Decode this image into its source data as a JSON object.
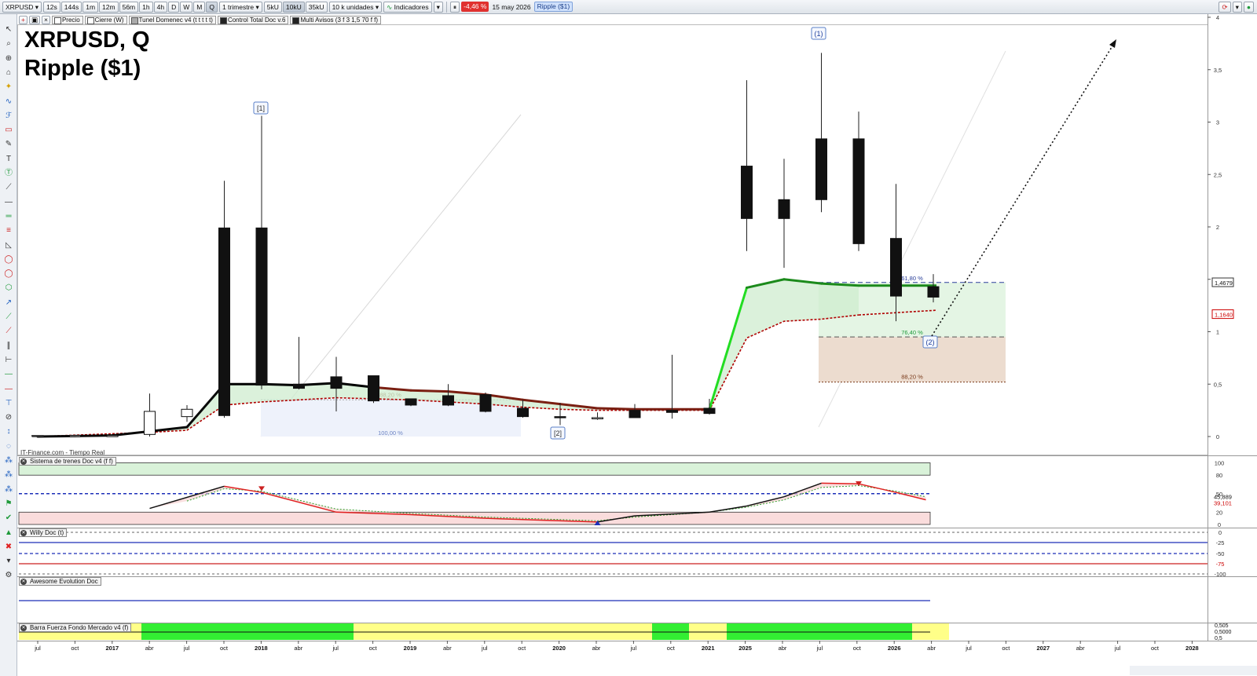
{
  "toolbar": {
    "symbol": "XRPUSD",
    "intervals": [
      "12s",
      "144s",
      "1m",
      "12m",
      "56m",
      "1h",
      "4h",
      "D",
      "W",
      "M",
      "Q"
    ],
    "selected_interval": "Q",
    "period": "1 trimestre",
    "units": [
      "5kU",
      "10kU",
      "35kU"
    ],
    "selected_unit": "10kU",
    "units_select": "10 k unidades",
    "indicators_label": "Indicadores",
    "change_pct": "-4,46 %",
    "date": "15 may 2026",
    "instrument_badge": "Ripple ($1)"
  },
  "legend": [
    "Precio",
    "Cierre (W)",
    "Tunel Domenec v4 (t t t t t)",
    "Control Total Doc v.6",
    "Multi Avisos (3 f 3 1,5 70 f f)"
  ],
  "title": {
    "line1": "XRPUSD, Q",
    "line2": "Ripple ($1)"
  },
  "source": "IT-Finance.com - Tiempo Real",
  "colors": {
    "bull": "#ffffff",
    "bear": "#111111",
    "tunnel_up": "#22dd22",
    "tunnel_flat": "#000000",
    "tunnel_down": "#7a1f12",
    "support_dash": "#b00000",
    "fib_fill_green": "#cdeccd",
    "fib_fill_brown": "#e8d6c8"
  },
  "y_axis": {
    "ticks": [
      "4",
      "3,5",
      "3",
      "2,5",
      "2",
      "1,5",
      "1",
      "0,5",
      "0"
    ],
    "current_price": "1,4679",
    "support_price": "1,1640"
  },
  "fib_labels": {
    "a": "61,80 %",
    "b": "76,40 %",
    "c": "88,20 %",
    "d": "88,20 %",
    "e": "100,00 %"
  },
  "wave_labels": {
    "w1": "[1]",
    "w2": "[2]",
    "w1b": "(1)",
    "w2b": "(2)"
  },
  "x_axis": [
    "jul",
    "oct",
    "2017",
    "abr",
    "jul",
    "oct",
    "2018",
    "abr",
    "jul",
    "oct",
    "2019",
    "abr",
    "jul",
    "oct",
    "2020",
    "abr",
    "jul",
    "oct",
    "2021",
    "2025",
    "abr",
    "jul",
    "oct",
    "2026",
    "abr",
    "jul",
    "oct",
    "2027",
    "abr",
    "jul",
    "oct",
    "2028"
  ],
  "chart_data": {
    "type": "candlestick",
    "timeframe": "Q",
    "y_range": [
      0,
      4
    ],
    "candles": [
      {
        "i": 0,
        "o": 0.01,
        "h": 0.01,
        "l": 0.0,
        "c": 0.01
      },
      {
        "i": 1,
        "o": 0.01,
        "h": 0.01,
        "l": 0.0,
        "c": 0.01
      },
      {
        "i": 2,
        "o": 0.01,
        "h": 0.01,
        "l": 0.0,
        "c": 0.01
      },
      {
        "i": 3,
        "o": 0.02,
        "h": 0.41,
        "l": 0.0,
        "c": 0.24
      },
      {
        "i": 4,
        "o": 0.19,
        "h": 0.3,
        "l": 0.14,
        "c": 0.26
      },
      {
        "i": 5,
        "o": 1.99,
        "h": 2.44,
        "l": 0.18,
        "c": 0.2
      },
      {
        "i": 6,
        "o": 1.99,
        "h": 3.06,
        "l": 0.45,
        "c": 0.49
      },
      {
        "i": 7,
        "o": 0.5,
        "h": 0.95,
        "l": 0.45,
        "c": 0.46
      },
      {
        "i": 8,
        "o": 0.57,
        "h": 0.76,
        "l": 0.24,
        "c": 0.46
      },
      {
        "i": 9,
        "o": 0.58,
        "h": 0.58,
        "l": 0.32,
        "c": 0.34
      },
      {
        "i": 10,
        "o": 0.36,
        "h": 0.36,
        "l": 0.29,
        "c": 0.3
      },
      {
        "i": 11,
        "o": 0.39,
        "h": 0.5,
        "l": 0.29,
        "c": 0.3
      },
      {
        "i": 12,
        "o": 0.4,
        "h": 0.42,
        "l": 0.23,
        "c": 0.24
      },
      {
        "i": 13,
        "o": 0.27,
        "h": 0.35,
        "l": 0.18,
        "c": 0.19
      },
      {
        "i": 14,
        "o": 0.19,
        "h": 0.32,
        "l": 0.11,
        "c": 0.18
      },
      {
        "i": 15,
        "o": 0.18,
        "h": 0.23,
        "l": 0.16,
        "c": 0.18
      },
      {
        "i": 16,
        "o": 0.25,
        "h": 0.31,
        "l": 0.18,
        "c": 0.18
      },
      {
        "i": 17,
        "o": 0.25,
        "h": 0.78,
        "l": 0.17,
        "c": 0.23
      },
      {
        "i": 18,
        "o": 0.27,
        "h": 0.36,
        "l": 0.21,
        "c": 0.22
      },
      {
        "i": 19,
        "o": 2.58,
        "h": 3.4,
        "l": 1.77,
        "c": 2.08
      },
      {
        "i": 20,
        "o": 2.26,
        "h": 2.65,
        "l": 1.61,
        "c": 2.08
      },
      {
        "i": 21,
        "o": 2.84,
        "h": 3.66,
        "l": 2.14,
        "c": 2.26
      },
      {
        "i": 22,
        "o": 2.84,
        "h": 3.1,
        "l": 1.77,
        "c": 1.84
      },
      {
        "i": 23,
        "o": 1.89,
        "h": 2.41,
        "l": 1.1,
        "c": 1.34
      },
      {
        "i": 24,
        "o": 1.43,
        "h": 1.55,
        "l": 1.28,
        "c": 1.33
      }
    ],
    "tunnel": [
      {
        "i": 0,
        "v": 0.0
      },
      {
        "i": 1,
        "v": 0.005
      },
      {
        "i": 2,
        "v": 0.01
      },
      {
        "i": 3,
        "v": 0.05
      },
      {
        "i": 4,
        "v": 0.09
      },
      {
        "i": 5,
        "v": 0.5
      },
      {
        "i": 6,
        "v": 0.5
      },
      {
        "i": 7,
        "v": 0.49
      },
      {
        "i": 8,
        "v": 0.51
      },
      {
        "i": 9,
        "v": 0.47
      },
      {
        "i": 10,
        "v": 0.44
      },
      {
        "i": 11,
        "v": 0.43
      },
      {
        "i": 12,
        "v": 0.4
      },
      {
        "i": 13,
        "v": 0.35
      },
      {
        "i": 14,
        "v": 0.31
      },
      {
        "i": 15,
        "v": 0.27
      },
      {
        "i": 16,
        "v": 0.26
      },
      {
        "i": 17,
        "v": 0.26
      },
      {
        "i": 18,
        "v": 0.26
      },
      {
        "i": 19,
        "v": 1.42
      },
      {
        "i": 20,
        "v": 1.5
      },
      {
        "i": 21,
        "v": 1.46
      },
      {
        "i": 22,
        "v": 1.44
      }
    ],
    "support": [
      {
        "i": 0,
        "v": 0.0
      },
      {
        "i": 3,
        "v": 0.04
      },
      {
        "i": 4,
        "v": 0.06
      },
      {
        "i": 5,
        "v": 0.3
      },
      {
        "i": 6,
        "v": 0.33
      },
      {
        "i": 7,
        "v": 0.35
      },
      {
        "i": 8,
        "v": 0.37
      },
      {
        "i": 9,
        "v": 0.36
      },
      {
        "i": 10,
        "v": 0.35
      },
      {
        "i": 11,
        "v": 0.33
      },
      {
        "i": 12,
        "v": 0.31
      },
      {
        "i": 13,
        "v": 0.28
      },
      {
        "i": 14,
        "v": 0.26
      },
      {
        "i": 15,
        "v": 0.25
      },
      {
        "i": 16,
        "v": 0.25
      },
      {
        "i": 17,
        "v": 0.25
      },
      {
        "i": 18,
        "v": 0.25
      },
      {
        "i": 19,
        "v": 0.94
      },
      {
        "i": 20,
        "v": 1.1
      },
      {
        "i": 21,
        "v": 1.12
      },
      {
        "i": 22,
        "v": 1.16
      }
    ]
  },
  "panels": {
    "trend": {
      "title": "Sistema de trenes Doc v4 (f f)",
      "ticks": [
        "100",
        "80",
        "50",
        "20",
        "0"
      ],
      "value1": "45,889",
      "value2": "39,101"
    },
    "willy": {
      "title": "Willy Doc (t)",
      "ticks": [
        "0",
        "-25",
        "-50",
        "-75",
        "-100"
      ]
    },
    "awesome": {
      "title": "Awesome Evolution Doc"
    },
    "barra": {
      "title": "Barra Fuerza Fondo Mercado v4 (f)",
      "value1": "0,505",
      "value2": "0,5000",
      "value3": "0,5"
    }
  }
}
